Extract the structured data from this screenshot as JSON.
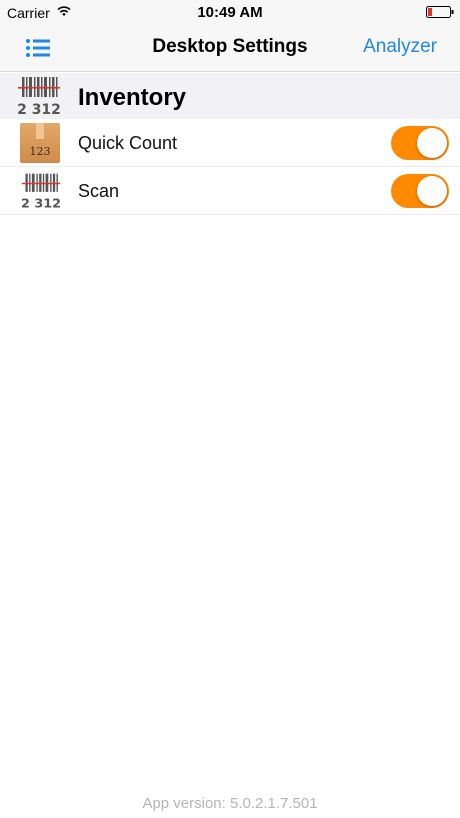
{
  "status_bar": {
    "carrier": "Carrier",
    "time": "10:49 AM",
    "battery_color": "#e0342b"
  },
  "nav": {
    "title": "Desktop Settings",
    "right_button": "Analyzer",
    "accent_color": "#1f88e0",
    "left_icon": "list-menu-icon"
  },
  "section": {
    "title": "Inventory",
    "icon": "barcode-icon",
    "icon_digits": "2 312"
  },
  "rows": [
    {
      "label": "Quick Count",
      "icon": "box-icon",
      "icon_digits": "123",
      "toggle_on": true
    },
    {
      "label": "Scan",
      "icon": "barcode-icon",
      "icon_digits": "2 312",
      "toggle_on": true
    }
  ],
  "toggle_color": "#ff8a00",
  "footer": {
    "version": "App version: 5.0.2.1.7.501"
  }
}
